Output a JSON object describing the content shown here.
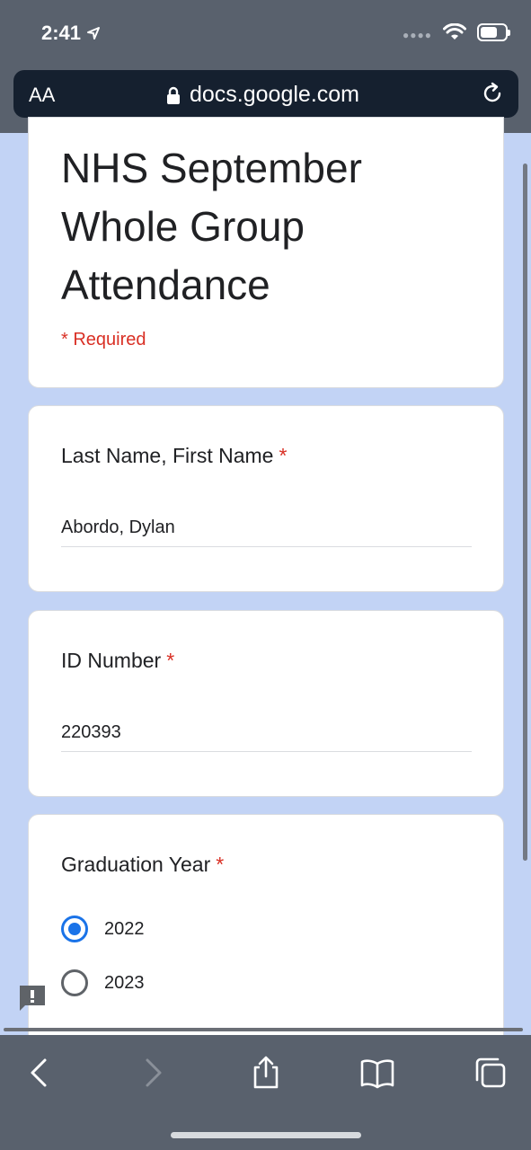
{
  "status_bar": {
    "time": "2:41"
  },
  "browser": {
    "text_size_button": "AA",
    "url": "docs.google.com"
  },
  "form": {
    "title": "NHS September Whole Group Attendance",
    "required_note": "* Required",
    "questions": [
      {
        "label": "Last Name, First Name",
        "required_mark": "*",
        "value": "Abordo, Dylan"
      },
      {
        "label": "ID Number",
        "required_mark": "*",
        "value": "220393"
      },
      {
        "label": "Graduation Year",
        "required_mark": "*",
        "options": [
          "2022",
          "2023"
        ],
        "selected": "2022"
      }
    ]
  },
  "colors": {
    "accent": "#1a73e8",
    "required": "#d93025",
    "page_bg": "#c2d3f5",
    "chrome": "#59616d"
  }
}
